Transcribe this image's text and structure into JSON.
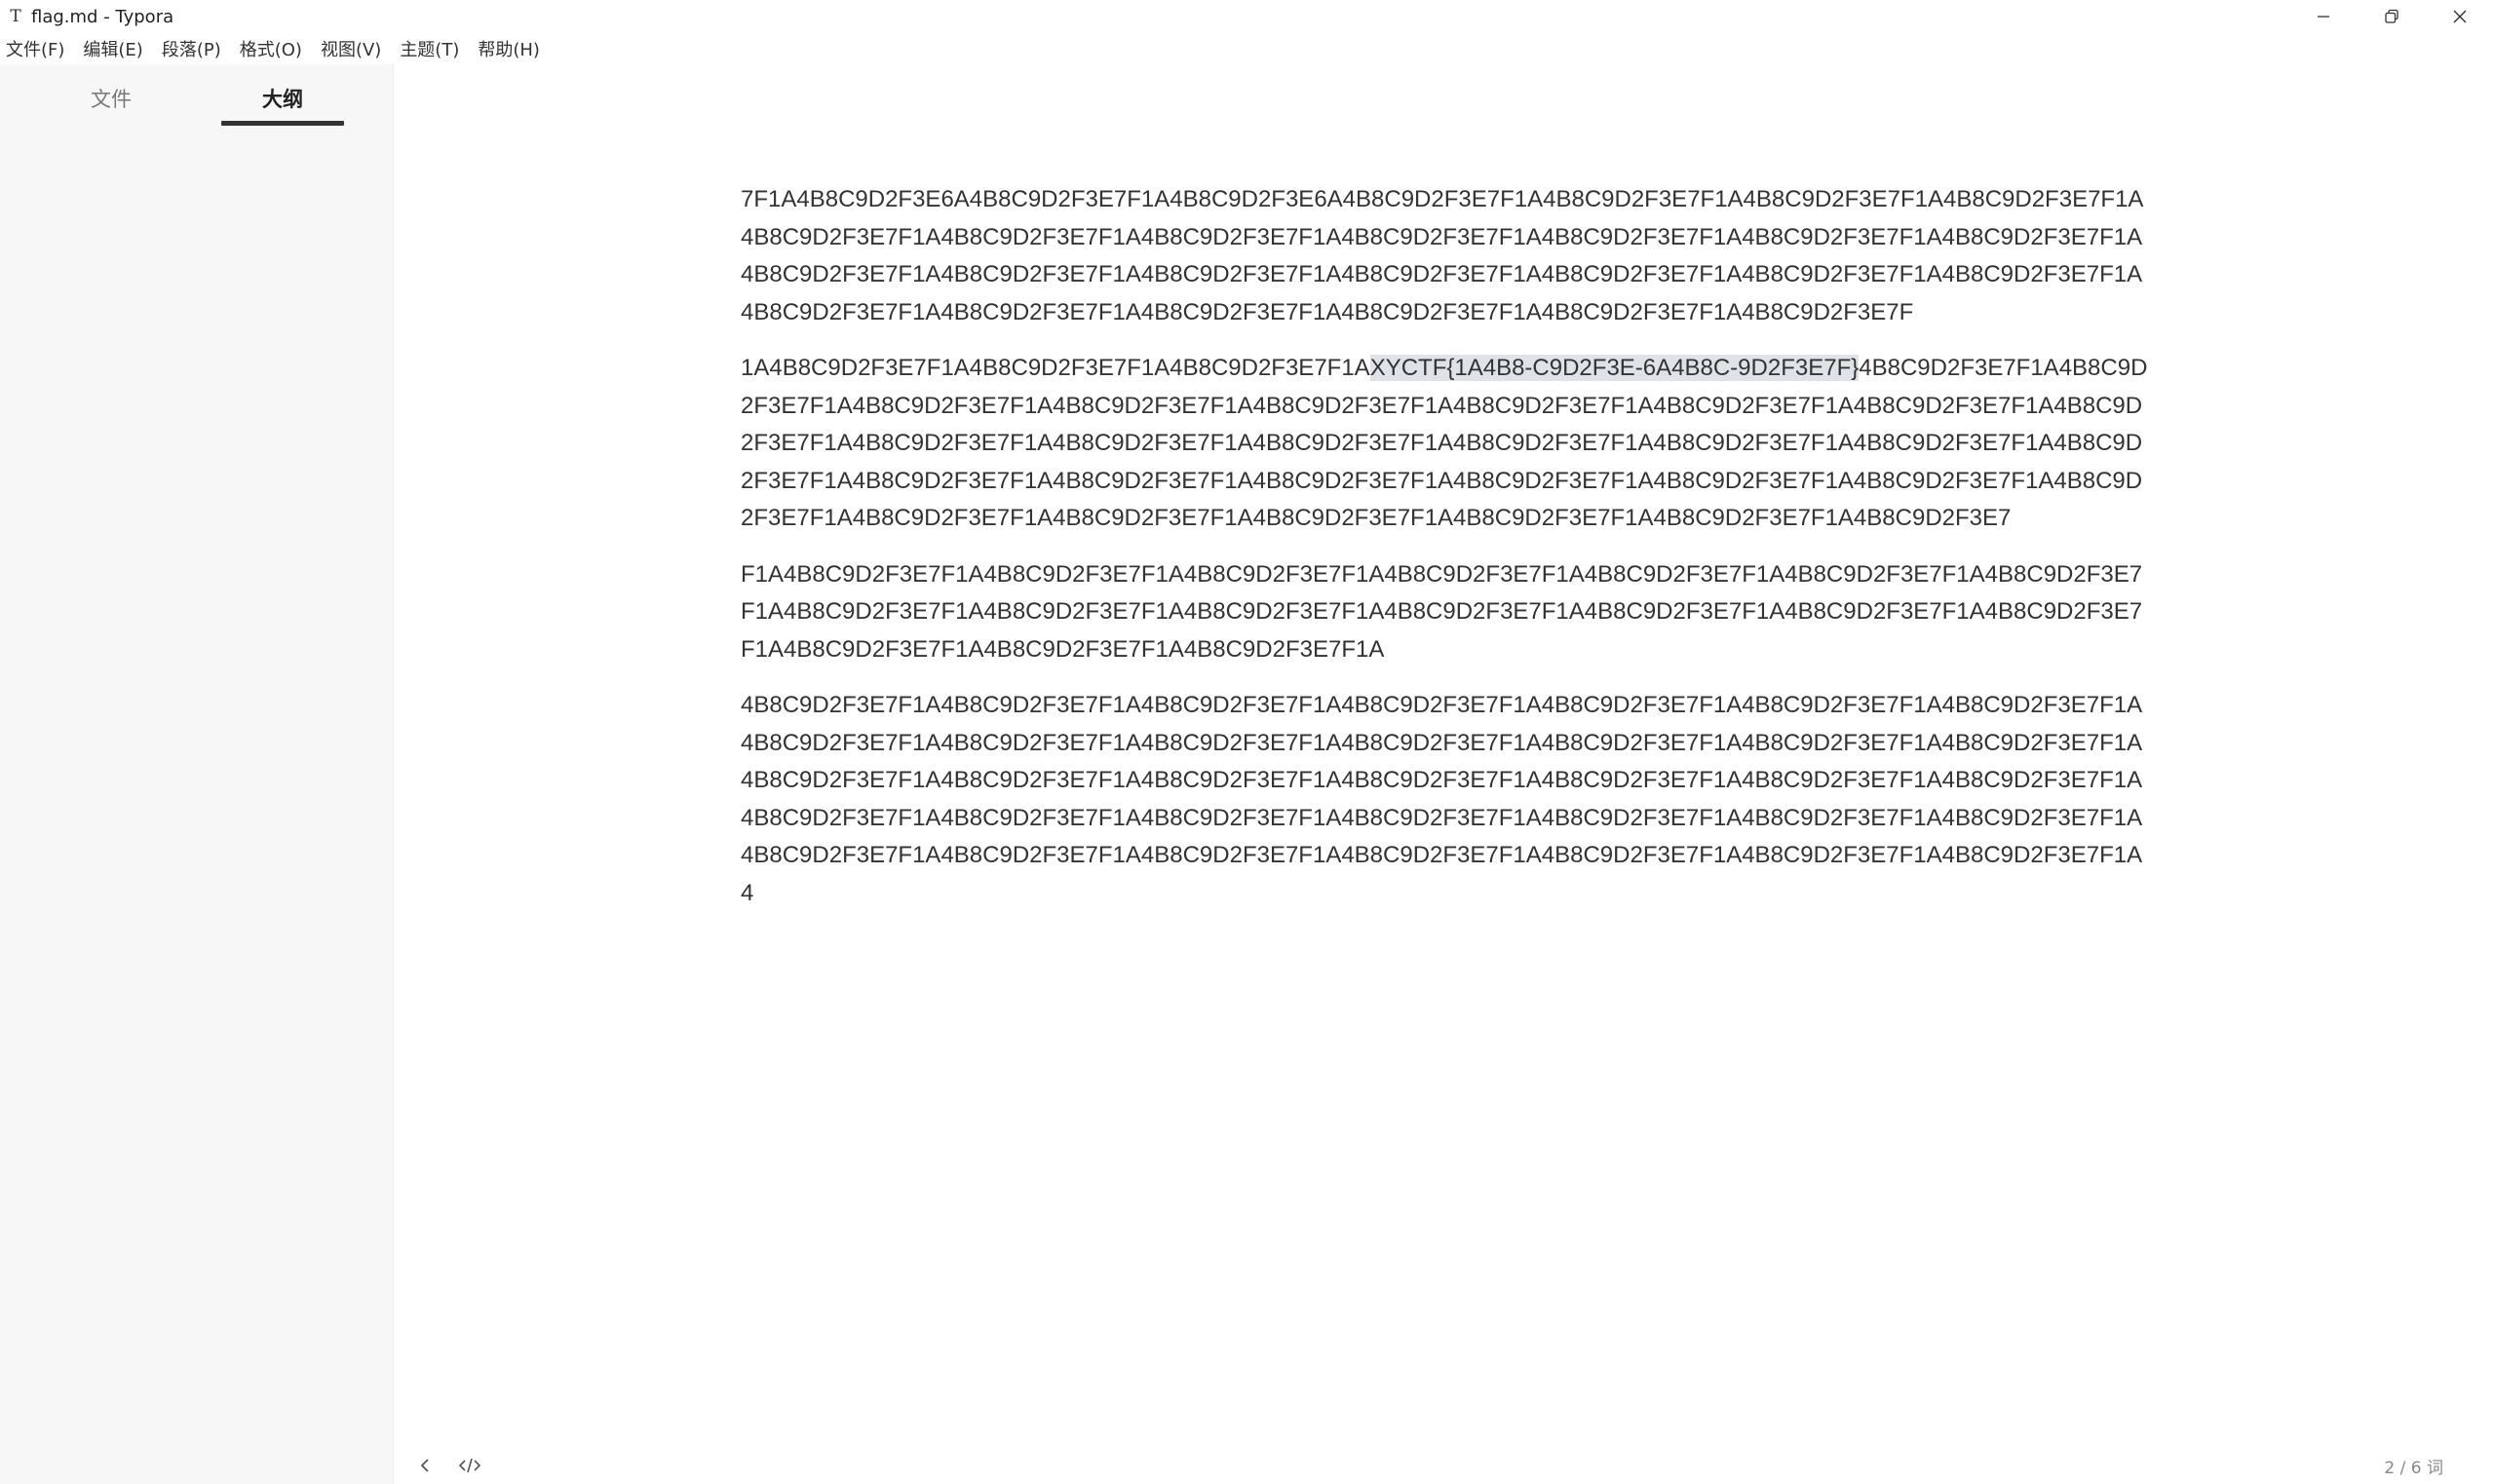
{
  "window": {
    "title": "flag.md - Typora",
    "app_icon": "T",
    "icons": [
      "minimize-icon",
      "restore-icon",
      "close-icon"
    ]
  },
  "menu": {
    "items": [
      "文件(F)",
      "编辑(E)",
      "段落(P)",
      "格式(O)",
      "视图(V)",
      "主题(T)",
      "帮助(H)"
    ]
  },
  "sidebar": {
    "tabs": [
      "文件",
      "大纲"
    ],
    "active_tab": "大纲"
  },
  "document": {
    "p1": "7F1A4B8C9D2F3E6A4B8C9D2F3E7F1A4B8C9D2F3E6A4B8C9D2F3E7F1A4B8C9D2F3E7F1A4B8C9D2F3E7F1A4B8C9D2F3E7F1A4B8C9D2F3E7F1A4B8C9D2F3E7F1A4B8C9D2F3E7F1A4B8C9D2F3E7F1A4B8C9D2F3E7F1A4B8C9D2F3E7F1A4B8C9D2F3E7F1A4B8C9D2F3E7F1A4B8C9D2F3E7F1A4B8C9D2F3E7F1A4B8C9D2F3E7F1A4B8C9D2F3E7F1A4B8C9D2F3E7F1A4B8C9D2F3E7F1A4B8C9D2F3E7F1A4B8C9D2F3E7F1A4B8C9D2F3E7F1A4B8C9D2F3E7F1A4B8C9D2F3E7F1A4B8C9D2F3E7F",
    "p2_before": "1A4B8C9D2F3E7F1A4B8C9D2F3E7F1A4B8C9D2F3E7F1A",
    "p2_selected": "XYCTF{1A4B8-C9D2F3E-6A4B8C-9D2F3E7F}",
    "p2_after": "4B8C9D2F3E7F1A4B8C9D2F3E7F1A4B8C9D2F3E7F1A4B8C9D2F3E7F1A4B8C9D2F3E7F1A4B8C9D2F3E7F1A4B8C9D2F3E7F1A4B8C9D2F3E7F1A4B8C9D2F3E7F1A4B8C9D2F3E7F1A4B8C9D2F3E7F1A4B8C9D2F3E7F1A4B8C9D2F3E7F1A4B8C9D2F3E7F1A4B8C9D2F3E7F1A4B8C9D2F3E7F1A4B8C9D2F3E7F1A4B8C9D2F3E7F1A4B8C9D2F3E7F1A4B8C9D2F3E7F1A4B8C9D2F3E7F1A4B8C9D2F3E7F1A4B8C9D2F3E7F1A4B8C9D2F3E7F1A4B8C9D2F3E7F1A4B8C9D2F3E7F1A4B8C9D2F3E7F1A4B8C9D2F3E7F1A4B8C9D2F3E7",
    "p3": "F1A4B8C9D2F3E7F1A4B8C9D2F3E7F1A4B8C9D2F3E7F1A4B8C9D2F3E7F1A4B8C9D2F3E7F1A4B8C9D2F3E7F1A4B8C9D2F3E7F1A4B8C9D2F3E7F1A4B8C9D2F3E7F1A4B8C9D2F3E7F1A4B8C9D2F3E7F1A4B8C9D2F3E7F1A4B8C9D2F3E7F1A4B8C9D2F3E7F1A4B8C9D2F3E7F1A4B8C9D2F3E7F1A4B8C9D2F3E7F1A",
    "p4": "4B8C9D2F3E7F1A4B8C9D2F3E7F1A4B8C9D2F3E7F1A4B8C9D2F3E7F1A4B8C9D2F3E7F1A4B8C9D2F3E7F1A4B8C9D2F3E7F1A4B8C9D2F3E7F1A4B8C9D2F3E7F1A4B8C9D2F3E7F1A4B8C9D2F3E7F1A4B8C9D2F3E7F1A4B8C9D2F3E7F1A4B8C9D2F3E7F1A4B8C9D2F3E7F1A4B8C9D2F3E7F1A4B8C9D2F3E7F1A4B8C9D2F3E7F1A4B8C9D2F3E7F1A4B8C9D2F3E7F1A4B8C9D2F3E7F1A4B8C9D2F3E7F1A4B8C9D2F3E7F1A4B8C9D2F3E7F1A4B8C9D2F3E7F1A4B8C9D2F3E7F1A4B8C9D2F3E7F1A4B8C9D2F3E7F1A4B8C9D2F3E7F1A4B8C9D2F3E7F1A4B8C9D2F3E7F1A4B8C9D2F3E7F1A4B8C9D2F3E7F1A4B8C9D2F3E7F1A4B8C9D2F3E7F1A4"
  },
  "footer": {
    "word_count": "2 / 6 词",
    "icons": [
      "chevron-left-icon",
      "source-code-icon"
    ]
  },
  "colors": {
    "sidebar_bg": "#f7f7f7",
    "selection_bg": "#dfe3e8",
    "text": "#333333"
  }
}
